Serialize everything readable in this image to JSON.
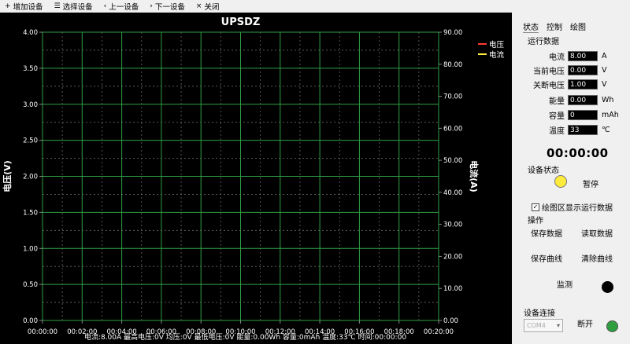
{
  "menubar": {
    "items": [
      {
        "icon": "+",
        "label": "增加设备"
      },
      {
        "icon": "☰",
        "label": "选择设备"
      },
      {
        "icon": "‹",
        "label": "上一设备"
      },
      {
        "icon": "›",
        "label": "下一设备"
      },
      {
        "icon": "×",
        "label": "关闭"
      }
    ]
  },
  "chart": {
    "title": "UPSDZ",
    "left_axis_label": "电压(V)",
    "right_axis_label": "电流(A)",
    "legend": [
      {
        "name": "电压",
        "color": "#ff3b30"
      },
      {
        "name": "电流",
        "color": "#ffeb3b"
      }
    ],
    "footer": "电流:8.00A 最高电压:0V 均压:0V 最低电压:0V 能量:0.00Wh 容量:0mAh 温度:33℃ 时间:00:00:00",
    "grid_color": "#2ea043"
  },
  "chart_data": {
    "type": "line",
    "title": "UPSDZ",
    "xlabel": "",
    "ylabel": "电压(V)",
    "y2label": "电流(A)",
    "x_ticks": [
      "00:00:00",
      "00:02:00",
      "00:04:00",
      "00:06:00",
      "00:08:00",
      "00:10:00",
      "00:12:00",
      "00:14:00",
      "00:16:00",
      "00:18:00",
      "00:20:00"
    ],
    "left_ticks": [
      "0.00",
      "0.50",
      "1.00",
      "1.50",
      "2.00",
      "2.50",
      "3.00",
      "3.50",
      "4.00"
    ],
    "right_ticks": [
      "0.00",
      "10.00",
      "20.00",
      "30.00",
      "40.00",
      "50.00",
      "60.00",
      "70.00",
      "80.00",
      "90.00"
    ],
    "ylim": [
      0,
      4
    ],
    "y2lim": [
      0,
      90
    ],
    "xlim": [
      "00:00:00",
      "00:20:00"
    ],
    "series": [
      {
        "name": "电压",
        "values": []
      },
      {
        "name": "电流",
        "values": []
      }
    ],
    "legend_position": "top-right",
    "grid": true
  },
  "panel": {
    "tabs": [
      "状态",
      "控制",
      "绘图"
    ],
    "section_running": "运行数据",
    "rows": [
      {
        "label": "电流",
        "value": "8.00",
        "unit": "A"
      },
      {
        "label": "当前电压",
        "value": "0.00",
        "unit": "V"
      },
      {
        "label": "关断电压",
        "value": "1.00",
        "unit": "V"
      },
      {
        "label": "能量",
        "value": "0.00",
        "unit": "Wh"
      },
      {
        "label": "容量",
        "value": "0",
        "unit": "mAh"
      },
      {
        "label": "温度",
        "value": "33",
        "unit": "℃"
      }
    ],
    "timer": "00:00:00",
    "device_status_label": "设备状态",
    "device_status_value": "暂停",
    "status_color": "#ffeb3b",
    "checkbox_label": "绘图区显示运行数据",
    "checkbox_mark": "✓",
    "operations_label": "操作",
    "buttons": {
      "save_data": "保存数据",
      "read_data": "读取数据",
      "save_curve": "保存曲线",
      "clear_curve": "清除曲线",
      "monitor": "监测"
    },
    "connection_label": "设备连接",
    "port_value": "COM4",
    "disconnect": "断开",
    "connection_color": "#2e9e3e"
  }
}
